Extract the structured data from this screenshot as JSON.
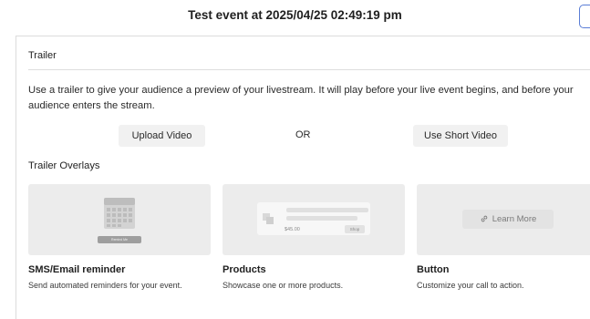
{
  "header": {
    "title": "Test event at 2025/04/25 02:49:19 pm"
  },
  "section": {
    "title": "Trailer",
    "description": "Use a trailer to give your audience a preview of your livestream. It will play before your live event begins, and before your audience enters the stream.",
    "upload_label": "Upload Video",
    "or_label": "OR",
    "short_label": "Use Short Video"
  },
  "overlays": {
    "title": "Trailer Overlays",
    "cards": [
      {
        "title": "SMS/Email reminder",
        "desc": "Send automated reminders for your event.",
        "thumb_label": "Remind Me",
        "icon": "calendar-icon"
      },
      {
        "title": "Products",
        "desc": "Showcase one or more products.",
        "price": "$45.00",
        "shop_label": "Shop",
        "icon": "product-image-icon"
      },
      {
        "title": "Button",
        "desc": "Customize your call to action.",
        "button_label": "Learn More",
        "icon": "link-icon"
      }
    ]
  },
  "colors": {
    "accent_border": "#5a7dd6",
    "thumb_bg": "#ececec",
    "button_bg": "#f1f1f1"
  }
}
